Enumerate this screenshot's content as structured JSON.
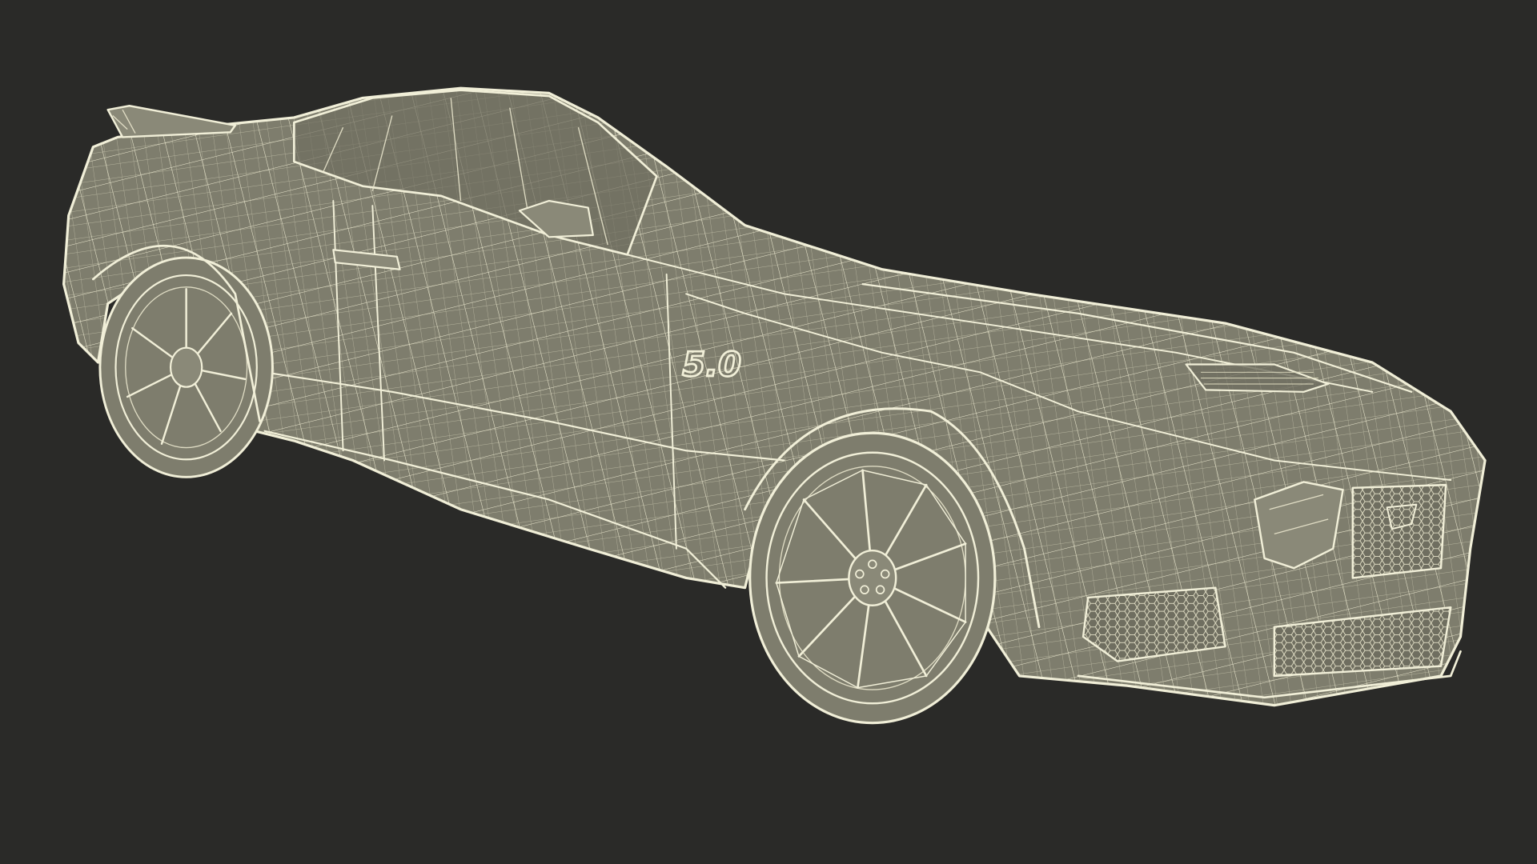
{
  "scene": {
    "background_color": "#2a2a28",
    "body_color": "#7e7d6d",
    "wire_color": "#f1efd8",
    "subject": "sports-coupe-wireframe",
    "badge_text": "5.0"
  }
}
